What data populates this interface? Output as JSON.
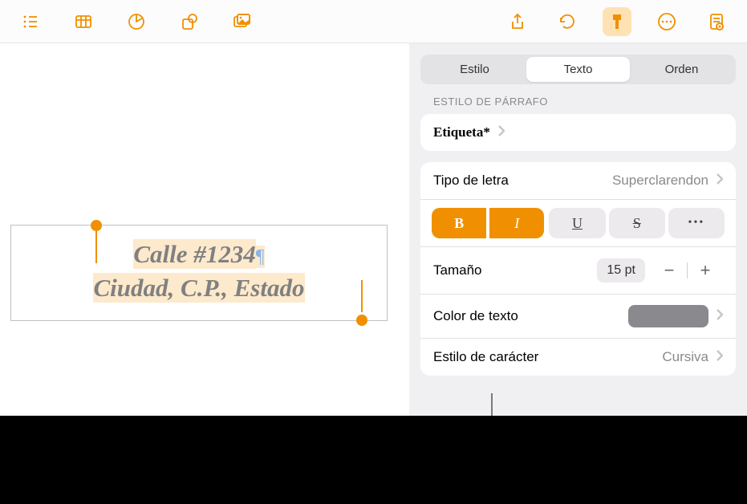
{
  "toolbar": {
    "left_icons": [
      "list-icon",
      "table-icon",
      "chart-icon",
      "shape-icon",
      "media-icon"
    ],
    "right_icons": [
      "share-icon",
      "undo-icon",
      "format-icon",
      "more-icon",
      "document-icon"
    ]
  },
  "canvas": {
    "line1": "Calle #1234",
    "line2": "Ciudad, C.P., Estado"
  },
  "inspector": {
    "tabs": [
      "Estilo",
      "Texto",
      "Orden"
    ],
    "active_tab": 1,
    "section_label": "ESTILO DE PÁRRAFO",
    "paragraph_style": "Etiqueta*",
    "font_label": "Tipo de letra",
    "font_value": "Superclarendon",
    "bold": "B",
    "italic": "I",
    "underline": "U",
    "strike": "S",
    "more": "•••",
    "size_label": "Tamaño",
    "size_value": "15 pt",
    "minus": "−",
    "plus": "+",
    "color_label": "Color de texto",
    "charstyle_label": "Estilo de carácter",
    "charstyle_value": "Cursiva"
  },
  "colors": {
    "accent": "#f09000",
    "text_color_swatch": "#8a8a8e"
  }
}
